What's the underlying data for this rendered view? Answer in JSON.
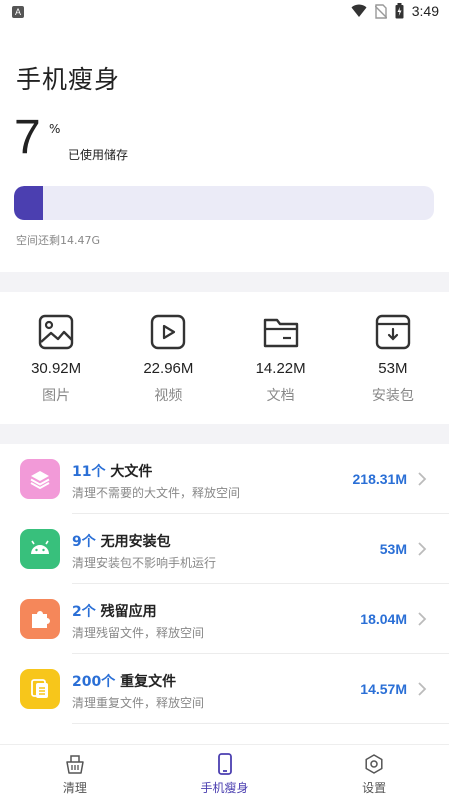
{
  "status_bar": {
    "notification_letter": "A",
    "time": "3:49",
    "icons": [
      "wifi-icon",
      "no-sim-icon",
      "battery-icon"
    ]
  },
  "page": {
    "title": "手机瘦身"
  },
  "storage": {
    "used_percent": "7",
    "percent_sign": "%",
    "used_label": "已使用储存",
    "remaining_text": "空间还剩14.47G",
    "progress_fraction": 0.07,
    "bar_color": "#4b3fb0",
    "track_color": "#ebebf7"
  },
  "categories": [
    {
      "icon": "image-icon",
      "size": "30.92M",
      "label": "图片"
    },
    {
      "icon": "video-icon",
      "size": "22.96M",
      "label": "视频"
    },
    {
      "icon": "folder-icon",
      "size": "14.22M",
      "label": "文档"
    },
    {
      "icon": "package-icon",
      "size": "53M",
      "label": "安装包"
    }
  ],
  "clean_items": [
    {
      "icon": "layers-icon",
      "icon_color": "#f29ad8",
      "count": "11个",
      "title": "大文件",
      "desc": "清理不需要的大文件，释放空间",
      "size": "218.31M"
    },
    {
      "icon": "android-icon",
      "icon_color": "#38c07c",
      "count": "9个",
      "title": "无用安装包",
      "desc": "清理安装包不影响手机运行",
      "size": "53M"
    },
    {
      "icon": "puzzle-icon",
      "icon_color": "#f5875a",
      "count": "2个",
      "title": "残留应用",
      "desc": "清理残留文件，释放空间",
      "size": "18.04M"
    },
    {
      "icon": "copy-icon",
      "icon_color": "#f7c61b",
      "count": "200个",
      "title": "重复文件",
      "desc": "清理重复文件，释放空间",
      "size": "14.57M"
    }
  ],
  "colors": {
    "accent_blue": "#2a6fd6",
    "accent_purple": "#4b3fb0"
  },
  "bottom_nav": [
    {
      "icon": "basket-icon",
      "label": "清理",
      "active": false
    },
    {
      "icon": "phone-icon",
      "label": "手机瘦身",
      "active": true
    },
    {
      "icon": "gear-icon",
      "label": "设置",
      "active": false
    }
  ]
}
